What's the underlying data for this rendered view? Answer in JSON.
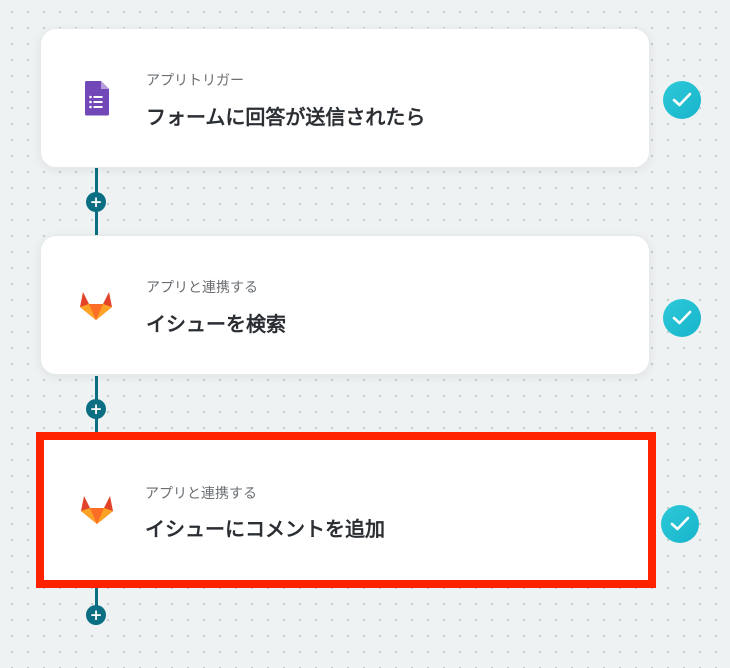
{
  "steps": [
    {
      "subtitle": "アプリトリガー",
      "title": "フォームに回答が送信されたら",
      "icon": "google-forms-icon",
      "completed": true
    },
    {
      "subtitle": "アプリと連携する",
      "title": "イシューを検索",
      "icon": "gitlab-icon",
      "completed": true
    },
    {
      "subtitle": "アプリと連携する",
      "title": "イシューにコメントを追加",
      "icon": "gitlab-icon",
      "completed": true,
      "highlighted": true
    }
  ],
  "add_step_label": "+",
  "colors": {
    "connector": "#0b6e82",
    "check": "#1fbdd0",
    "highlight": "#ff2200",
    "forms": "#7248b9",
    "gitlab_orange": "#e24329",
    "gitlab_light": "#fca326"
  }
}
